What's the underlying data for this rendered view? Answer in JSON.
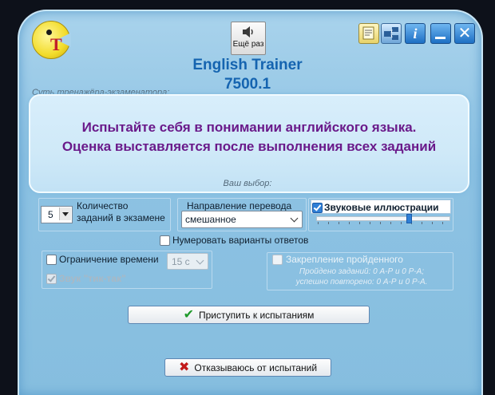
{
  "window": {
    "app_name": "English Trainer",
    "version": "7500.1",
    "subtitle": "Суть тренажёра-экзаменатора:",
    "repeat_sound_label": "Ещё раз",
    "titlebar_icons": [
      "notes-icon",
      "network-icon",
      "info-icon",
      "minimize-icon",
      "close-icon"
    ],
    "info_glyph": "i",
    "close_glyph": "✕"
  },
  "message": {
    "line1": "Испытайте себя в понимании английского языка.",
    "line2": "Оценка выставляется после выполнения всех заданий"
  },
  "choice_label": "Ваш выбор:",
  "options": {
    "task_count": {
      "value": "5",
      "label_line1": "Количество",
      "label_line2": "заданий в экзамене"
    },
    "direction": {
      "label": "Направление перевода",
      "value": "смешанное"
    },
    "sound_illustrations": {
      "label": "Звуковые иллюстрации",
      "checked": true,
      "volume": 0.7
    },
    "number_answers": {
      "label": "Нумеровать варианты ответов",
      "checked": false
    },
    "time_limit": {
      "label": "Ограничение времени",
      "checked": false,
      "value": "15 с"
    },
    "tick_sound": {
      "label": "Звук \"тик-так\"",
      "checked": true,
      "enabled": false
    },
    "consolidation": {
      "label": "Закрепление пройденного",
      "checked": false,
      "enabled": false,
      "passed_line": "Пройдено заданий: 0 А-Р и 0 Р-А;",
      "repeated_line": "успешно повторено: 0 А-Р и 0 Р-А."
    }
  },
  "buttons": {
    "start": "Приступить к испытаниям",
    "refuse": "Отказываюсь от испытаний"
  },
  "colors": {
    "background": "#0d111a",
    "frame": "#8dc2e3",
    "title": "#1564b0",
    "message": "#6a1a8a",
    "accent": "#2f7fd6"
  }
}
